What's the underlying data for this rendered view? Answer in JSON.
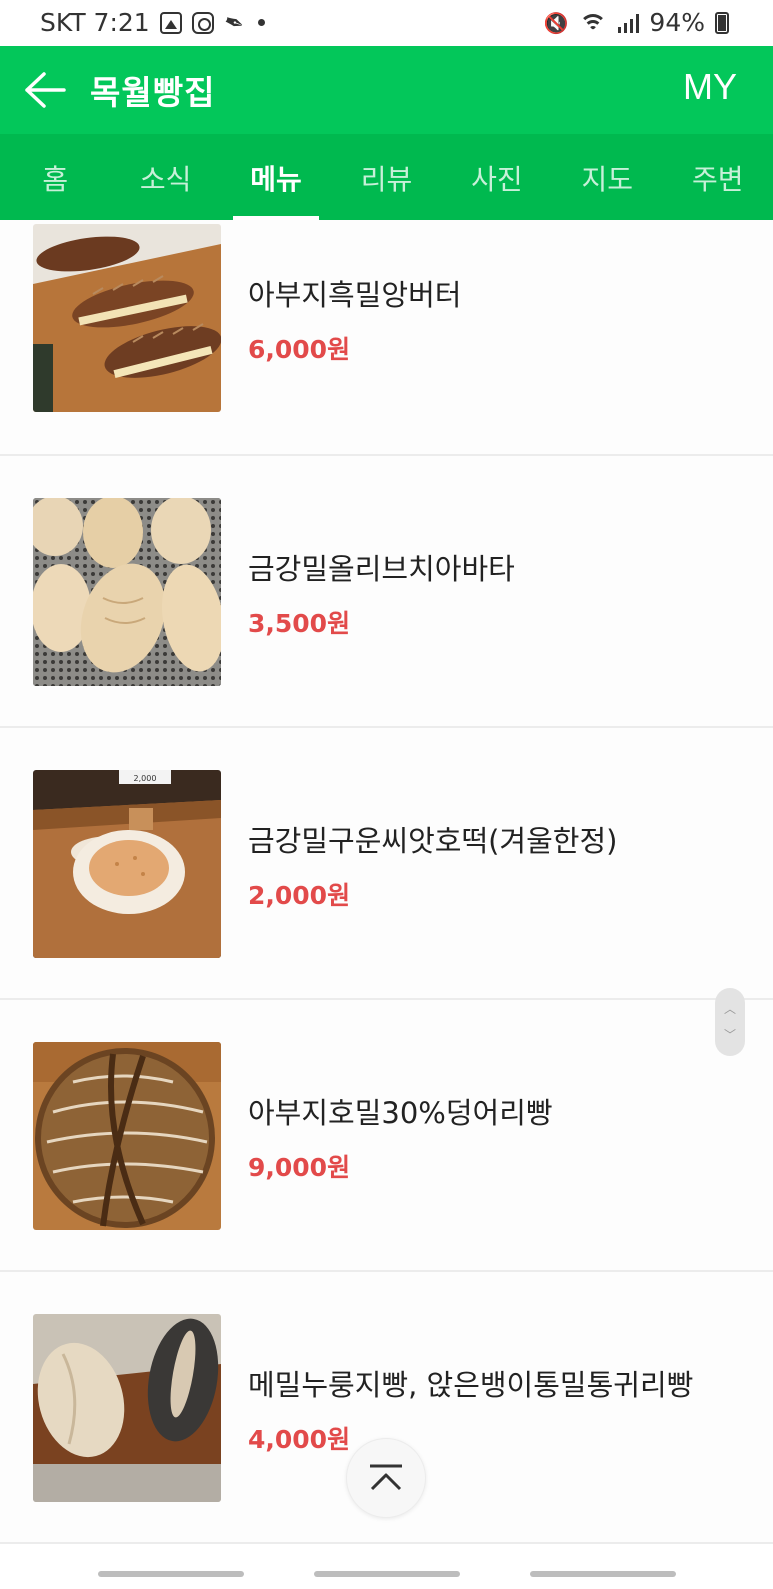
{
  "status_bar": {
    "carrier_time": "SKT 7:21",
    "battery": "94%"
  },
  "header": {
    "title": "목월빵집",
    "my_label": "MY"
  },
  "tabs": [
    {
      "label": "홈",
      "active": false
    },
    {
      "label": "소식",
      "active": false
    },
    {
      "label": "메뉴",
      "active": true
    },
    {
      "label": "리뷰",
      "active": false
    },
    {
      "label": "사진",
      "active": false
    },
    {
      "label": "지도",
      "active": false
    },
    {
      "label": "주변",
      "active": false
    }
  ],
  "menu": [
    {
      "name": "아부지흑밀앙버터",
      "price": "6,000원"
    },
    {
      "name": "금강밀올리브치아바타",
      "price": "3,500원"
    },
    {
      "name": "금강밀구운씨앗호떡(겨울한정)",
      "price": "2,000원"
    },
    {
      "name": "아부지호밀30%덩어리빵",
      "price": "9,000원"
    },
    {
      "name": "메밀누룽지빵, 앉은뱅이통밀통귀리빵",
      "price": "4,000원"
    }
  ],
  "photo_label": "2,000",
  "colors": {
    "brand_green": "#03c75a",
    "tab_green": "#00b94f",
    "price_red": "#e24a4a"
  }
}
